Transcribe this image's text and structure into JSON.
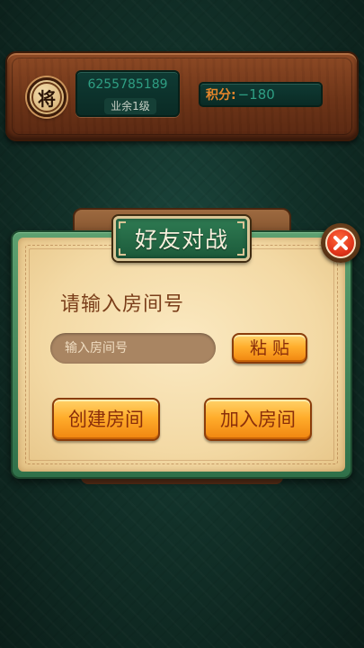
{
  "profile": {
    "avatar_char": "将",
    "player_id": "6255785189",
    "rank": "业余1级",
    "score_label": "积分:",
    "score_value": "−180"
  },
  "dialog": {
    "title": "好友对战",
    "prompt": "请输入房间号",
    "room_input": {
      "value": "",
      "placeholder": "输入房间号"
    },
    "paste_label": "粘贴",
    "create_label": "创建房间",
    "join_label": "加入房间",
    "close_icon": "close-icon"
  },
  "colors": {
    "background": "#123129",
    "wood_panel": "#6d3418",
    "dialog_frame": "#2f7049",
    "button_orange": "#ffad2c",
    "close_red": "#e2361c"
  }
}
